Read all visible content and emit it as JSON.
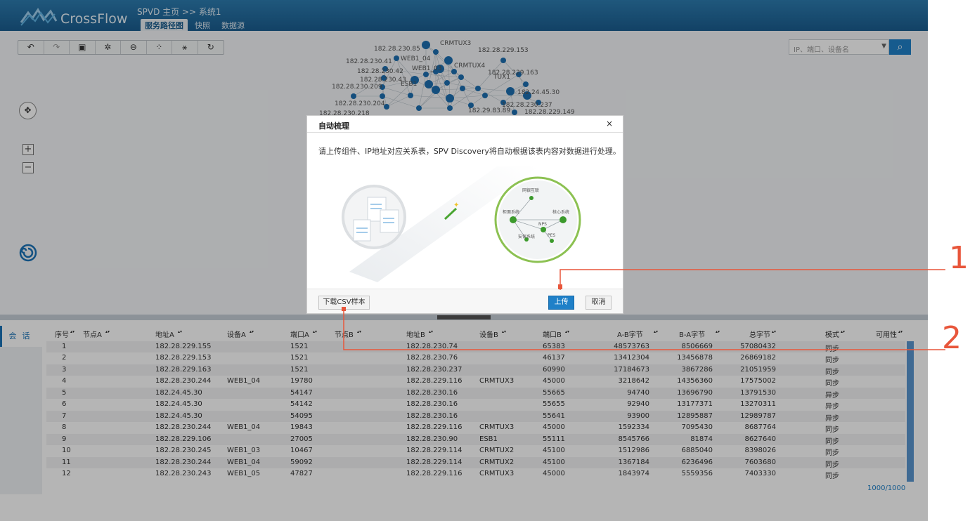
{
  "app": {
    "logo_text": "CrossFlow",
    "breadcrumb": "SPVD 主页  >> 系统1",
    "tabs": [
      "服务路径图",
      "快照",
      "数据源"
    ],
    "active_tab": 0
  },
  "search": {
    "placeholder": "IP、端口、设备名"
  },
  "toolbar": {
    "icons": [
      "undo-icon",
      "redo-icon",
      "save-icon",
      "settings-icon",
      "minus-circle-icon",
      "share-icon",
      "magic-wand-icon",
      "refresh-icon"
    ]
  },
  "graph_labels": [
    "182.28.230.85",
    "182.28.230.41",
    "182.28.230.42",
    "182.28.230.43",
    "182.28.230.209",
    "182.28.230.204",
    "182.28.230.218",
    "182.28.229.153",
    "182.28.229.163",
    "182.24.45.30",
    "182.28.230.237",
    "182.28.229.149",
    "182.29.83.89",
    "CRMTUX3",
    "CRMTUX4",
    "WEB1_04",
    "WEB1_03",
    "TUX1",
    "ESB1"
  ],
  "dialog": {
    "title": "自动梳理",
    "close": "×",
    "description": "请上传组件、IP地址对应关系表，SPV Discovery将自动根据该表内容对数据进行处理。",
    "diagram_labels": [
      "网银互联",
      "柜面系统",
      "核心系统",
      "NPS",
      "安保系统",
      "PES"
    ],
    "download_button": "下载CSV样本",
    "upload_button": "上传",
    "cancel_button": "取消"
  },
  "callouts": [
    "1",
    "2"
  ],
  "sidebar": {
    "tab": "会话"
  },
  "table": {
    "headers": [
      "序号",
      "节点A",
      "地址A",
      "设备A",
      "端口A",
      "节点B",
      "地址B",
      "设备B",
      "端口B",
      "A-B字节",
      "B-A字节",
      "总字节",
      "模式",
      "可用性"
    ],
    "rows": [
      [
        "1",
        "",
        "182.28.229.155",
        "",
        "1521",
        "",
        "182.28.230.74",
        "",
        "65383",
        "48573763",
        "8506669",
        "57080432",
        "同步",
        ""
      ],
      [
        "2",
        "",
        "182.28.229.153",
        "",
        "1521",
        "",
        "182.28.230.76",
        "",
        "46137",
        "13412304",
        "13456878",
        "26869182",
        "同步",
        ""
      ],
      [
        "3",
        "",
        "182.28.229.163",
        "",
        "1521",
        "",
        "182.28.230.237",
        "",
        "60990",
        "17184673",
        "3867286",
        "21051959",
        "同步",
        ""
      ],
      [
        "4",
        "",
        "182.28.230.244",
        "WEB1_04",
        "19780",
        "",
        "182.28.229.116",
        "CRMTUX3",
        "45000",
        "3218642",
        "14356360",
        "17575002",
        "同步",
        ""
      ],
      [
        "5",
        "",
        "182.24.45.30",
        "",
        "54147",
        "",
        "182.28.230.16",
        "",
        "55665",
        "94740",
        "13696790",
        "13791530",
        "异步",
        ""
      ],
      [
        "6",
        "",
        "182.24.45.30",
        "",
        "54142",
        "",
        "182.28.230.16",
        "",
        "55655",
        "92940",
        "13177371",
        "13270311",
        "异步",
        ""
      ],
      [
        "7",
        "",
        "182.24.45.30",
        "",
        "54095",
        "",
        "182.28.230.16",
        "",
        "55641",
        "93900",
        "12895887",
        "12989787",
        "异步",
        ""
      ],
      [
        "8",
        "",
        "182.28.230.244",
        "WEB1_04",
        "19843",
        "",
        "182.28.229.116",
        "CRMTUX3",
        "45000",
        "1592334",
        "7095430",
        "8687764",
        "同步",
        ""
      ],
      [
        "9",
        "",
        "182.28.229.106",
        "",
        "27005",
        "",
        "182.28.230.90",
        "ESB1",
        "55111",
        "8545766",
        "81874",
        "8627640",
        "同步",
        ""
      ],
      [
        "10",
        "",
        "182.28.230.245",
        "WEB1_03",
        "10467",
        "",
        "182.28.229.114",
        "CRMTUX2",
        "45100",
        "1512986",
        "6885040",
        "8398026",
        "同步",
        ""
      ],
      [
        "11",
        "",
        "182.28.230.244",
        "WEB1_04",
        "59092",
        "",
        "182.28.229.114",
        "CRMTUX2",
        "45100",
        "1367184",
        "6236496",
        "7603680",
        "同步",
        ""
      ],
      [
        "12",
        "",
        "182.28.230.243",
        "WEB1_05",
        "47827",
        "",
        "182.28.229.116",
        "CRMTUX3",
        "45000",
        "1843974",
        "5559356",
        "7403330",
        "同步",
        ""
      ]
    ],
    "count": "1000/1000"
  }
}
